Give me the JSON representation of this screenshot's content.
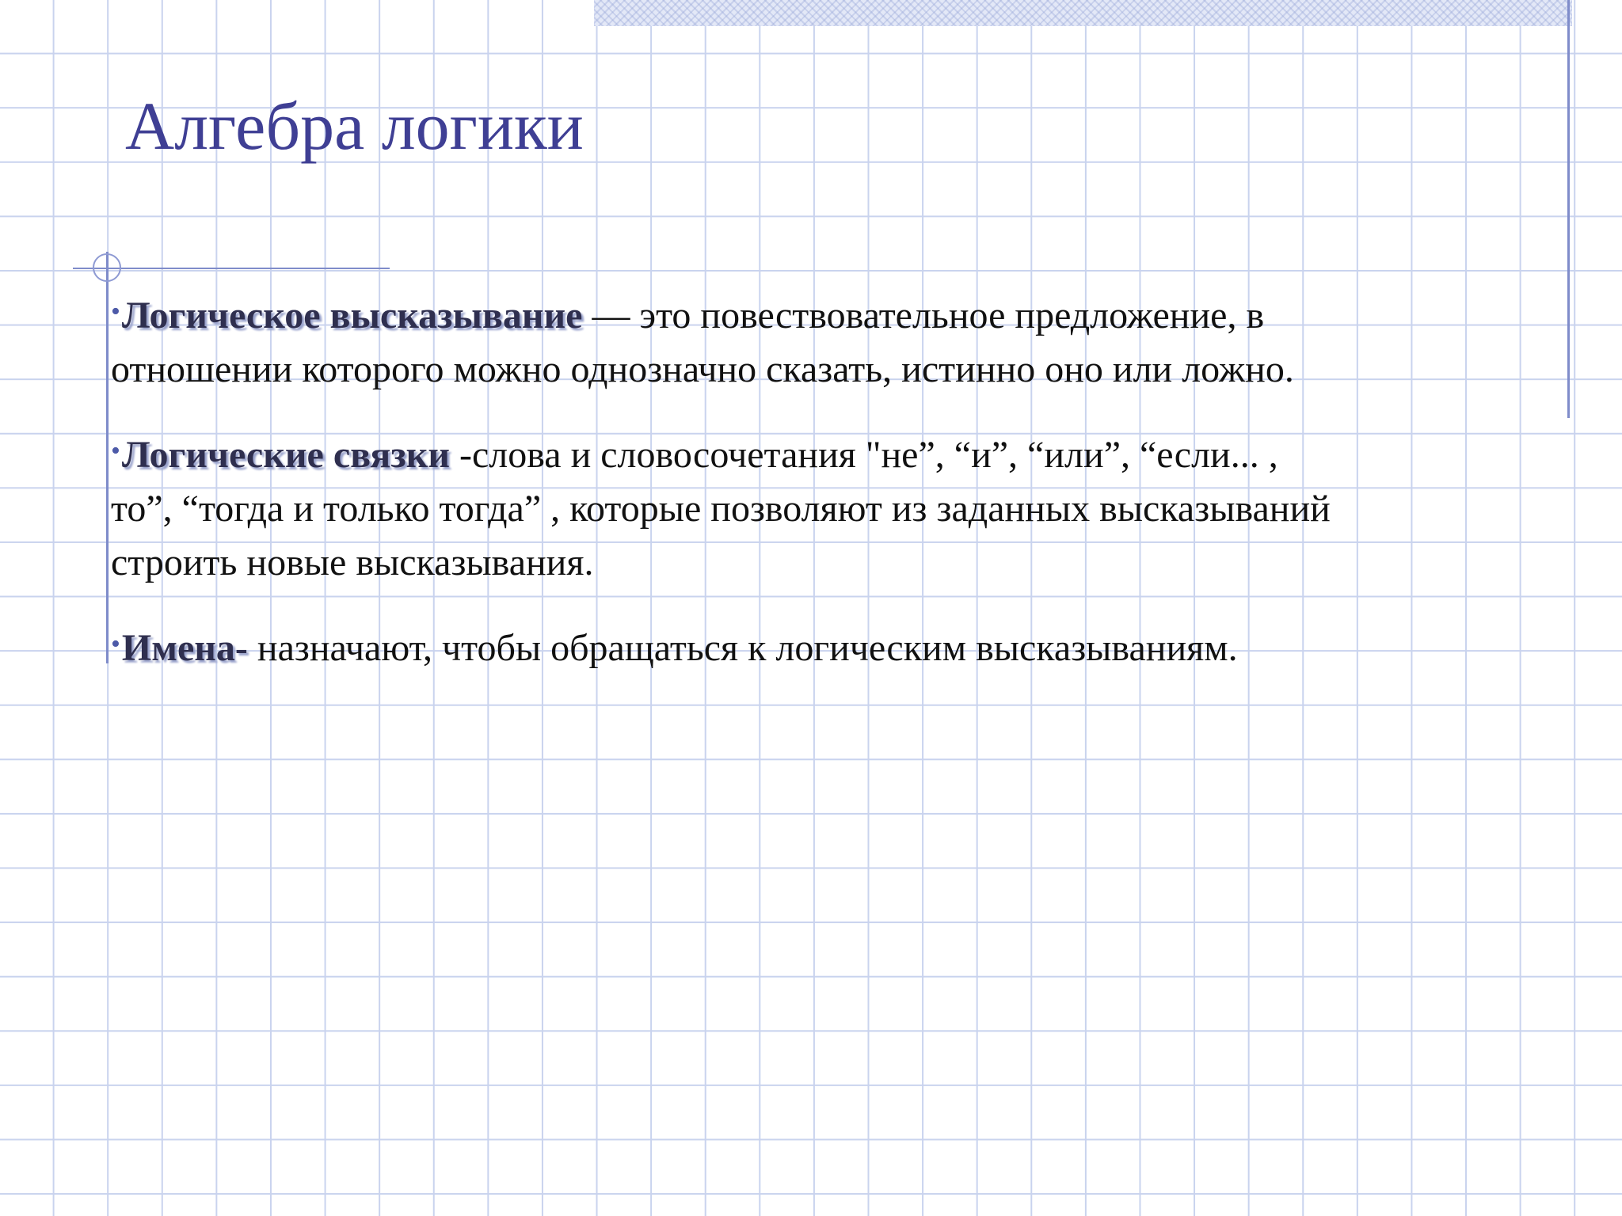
{
  "slide": {
    "title": "Алгебра логики",
    "bullet_glyph": "•",
    "paragraphs": [
      {
        "term": "Логическое высказывание",
        "text": " — это повествовательное предложение, в отношении которого можно однозначно сказать, истинно оно или ложно."
      },
      {
        "term": "Логические связки",
        "text": " -слова и словосочетания \"не”, “и”, “или”, “если... , то”, “тогда и только тогда” , которые позволяют из заданных высказываний строить новые высказывания."
      },
      {
        "term": "Имена-",
        "text": " назначают, чтобы обращаться к логическим высказываниям."
      }
    ]
  },
  "colors": {
    "title": "#3f3f94",
    "grid": "#c9d3ee",
    "accent_rule": "#7f8cca",
    "body_text": "#111111"
  }
}
